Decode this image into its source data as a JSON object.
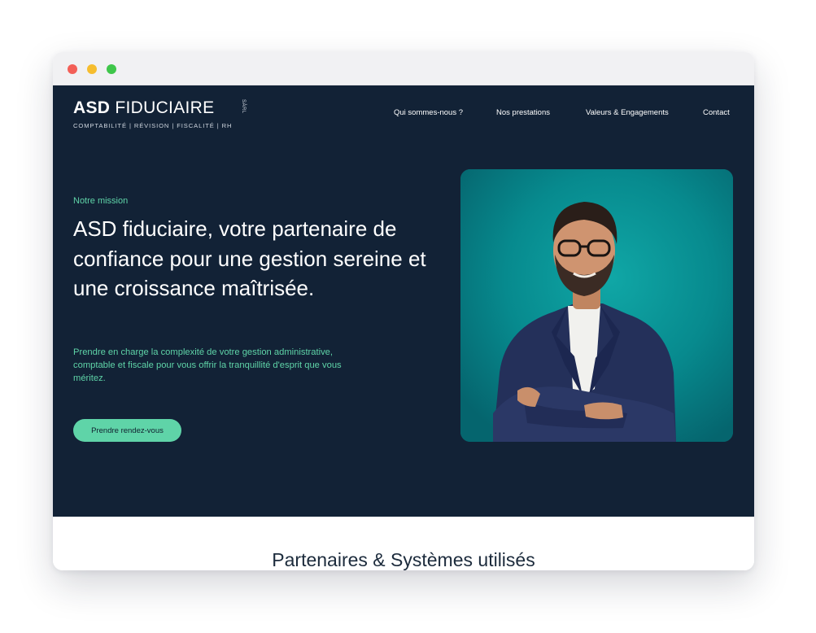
{
  "window": {
    "controls": [
      "close",
      "minimize",
      "maximize"
    ]
  },
  "logo": {
    "brand_bold": "ASD",
    "brand_light": "FIDUCIAIRE",
    "legal_form": "SÀRL",
    "tagline": "COMPTABILITÉ  |  RÉVISION  |  FISCALITÉ  |  RH"
  },
  "nav": {
    "items": [
      {
        "label": "Qui sommes-nous ?"
      },
      {
        "label": "Nos prestations"
      },
      {
        "label": "Valeurs & Engagements"
      },
      {
        "label": "Contact"
      }
    ]
  },
  "hero": {
    "eyebrow": "Notre mission",
    "headline": "ASD fiduciaire, votre partenaire de confiance pour une gestion sereine et une croissance maîtrisée.",
    "lead": "Prendre en charge la complexité de votre gestion administrative, comptable et fiscale pour vous offrir la tranquillité d'esprit que vous méritez.",
    "cta_label": "Prendre rendez-vous",
    "photo_icon": "portrait-photo"
  },
  "partners": {
    "title": "Partenaires & Systèmes utilisés"
  },
  "colors": {
    "hero_background": "#122236",
    "accent": "#5fd4a8",
    "photo_background": "#08888c"
  }
}
